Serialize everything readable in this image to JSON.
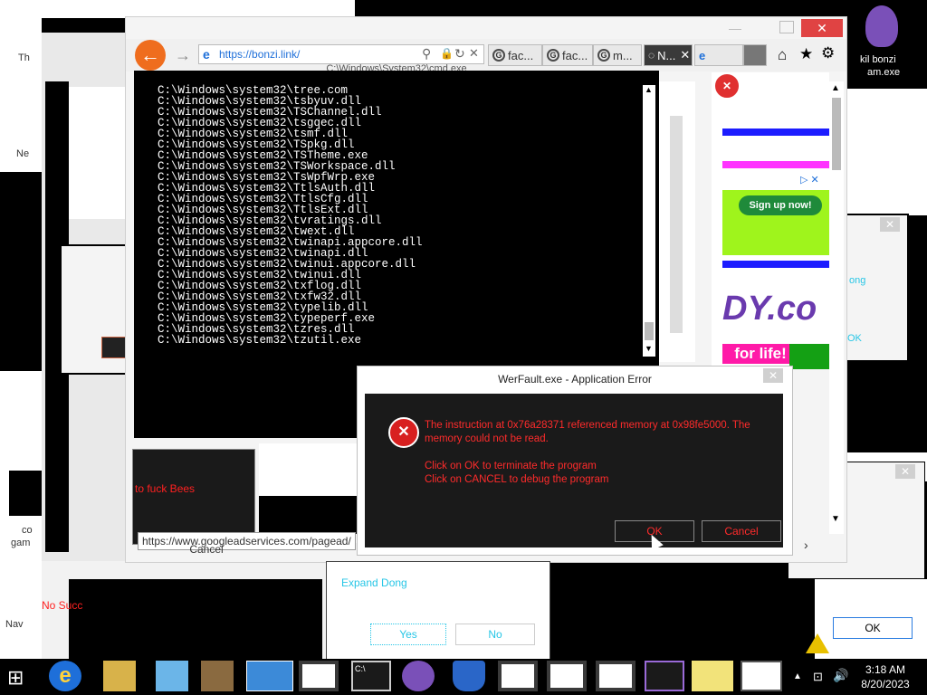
{
  "browser": {
    "url": "https://bonzi.link/",
    "tabs": [
      "fac...",
      "fac...",
      "m...",
      "N...",
      ""
    ],
    "status_url": "https://www.googleadservices.com/pagead/",
    "console_title": "C:\\Windows\\System32\\cmd.exe"
  },
  "console": {
    "lines": [
      "C:\\Windows\\system32\\tree.com",
      "C:\\Windows\\system32\\tsbyuv.dll",
      "C:\\Windows\\system32\\TSChannel.dll",
      "C:\\Windows\\system32\\tsgqec.dll",
      "C:\\Windows\\system32\\tsmf.dll",
      "C:\\Windows\\system32\\TSpkg.dll",
      "C:\\Windows\\system32\\TSTheme.exe",
      "C:\\Windows\\system32\\TSWorkspace.dll",
      "C:\\Windows\\system32\\TsWpfWrp.exe",
      "C:\\Windows\\system32\\TtlsAuth.dll",
      "C:\\Windows\\system32\\TtlsCfg.dll",
      "C:\\Windows\\system32\\TtlsExt.dll",
      "C:\\Windows\\system32\\tvratings.dll",
      "C:\\Windows\\system32\\twext.dll",
      "C:\\Windows\\system32\\twinapi.appcore.dll",
      "C:\\Windows\\system32\\twinapi.dll",
      "C:\\Windows\\system32\\twinui.appcore.dll",
      "C:\\Windows\\system32\\twinui.dll",
      "C:\\Windows\\system32\\txflog.dll",
      "C:\\Windows\\system32\\txfw32.dll",
      "C:\\Windows\\system32\\typelib.dll",
      "C:\\Windows\\system32\\typeperf.exe",
      "C:\\Windows\\system32\\tzres.dll",
      "C:\\Windows\\system32\\tzutil.exe"
    ]
  },
  "error_dialog": {
    "title": "WerFault.exe - Application Error",
    "message": "The instruction at 0x76a28371 referenced memory at 0x98fe5000. The memory could not be read.",
    "instruction_ok": "Click on OK to terminate the program",
    "instruction_cancel": "Click on CANCEL to debug the program",
    "ok_label": "OK",
    "cancel_label": "Cancel"
  },
  "ad": {
    "signup_label": "Sign up now!",
    "domain_fragment": "DY.co",
    "tagline": "for life!"
  },
  "background": {
    "bees_text": "to fuck Bees",
    "cancel_label": "Cancel",
    "expand_text": "Expand Dong",
    "yes_label": "Yes",
    "no_label": "No",
    "no_succ_text": "No Succ",
    "ok_label": "OK",
    "dong_fragment": "ong",
    "ok_fragment": "OK"
  },
  "desktop": {
    "bonzi_label_1": "kil bonzi",
    "bonzi_label_2": "am.exe",
    "left_label_1": "Th",
    "left_label_2": "Ne",
    "left_label_3": "co",
    "left_label_4": "gam",
    "left_label_5": "Nav"
  },
  "taskbar": {
    "time": "3:18 AM",
    "date": "8/20/2023",
    "cmd_label": "C:\\"
  },
  "colors": {
    "error_text": "#ff2b2b",
    "accent_cyan": "#27c6e6",
    "ie_blue": "#1e6fd9"
  }
}
